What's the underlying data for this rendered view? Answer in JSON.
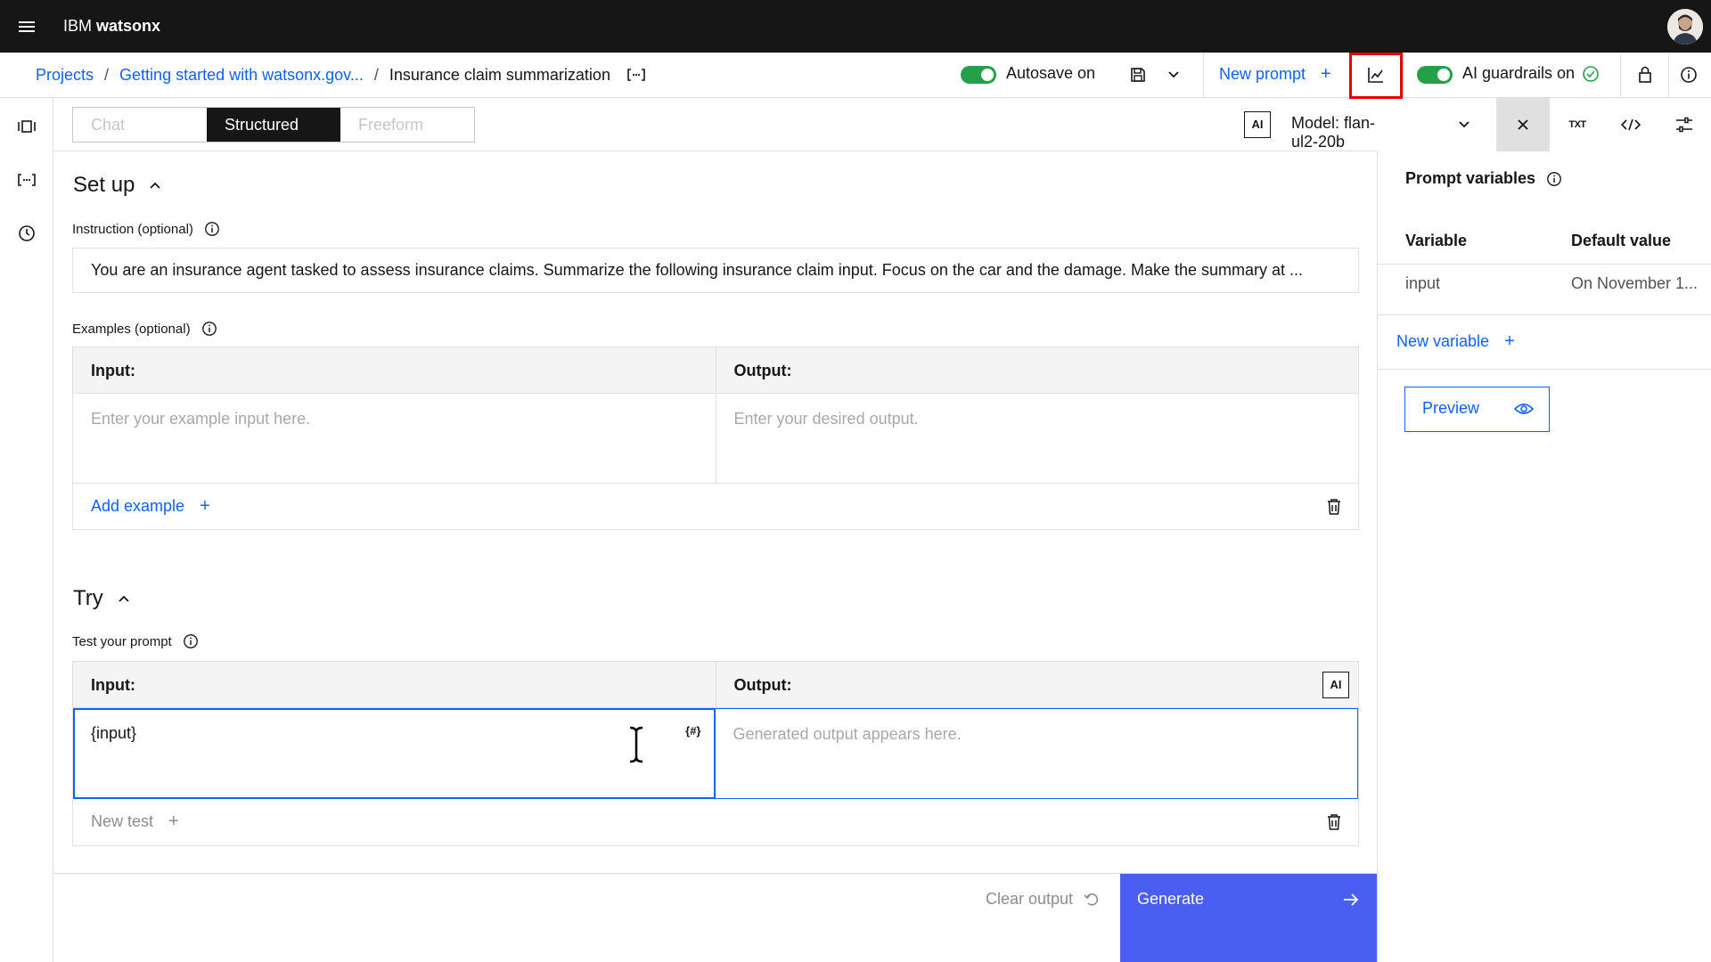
{
  "header": {
    "menu_icon": "hamburger-menu-icon",
    "brand_prefix": "IBM",
    "brand_name": "watsonx",
    "avatar_icon": "user-avatar"
  },
  "breadcrumb": {
    "items": [
      "Projects",
      "Getting started with watsonx.gov...",
      "Insurance claim summarization"
    ],
    "separator": "/",
    "variables_icon": "prompt-variables-icon"
  },
  "toolbar": {
    "autosave_label": "Autosave on",
    "save_icon": "save-icon",
    "dropdown_icon": "chevron-down-icon",
    "new_prompt_label": "New prompt",
    "new_prompt_icon": "plus-icon",
    "evaluate_icon": "chart-line-icon",
    "guardrails_label": "AI guardrails on",
    "guardrails_icon": "checkmark-outline-icon",
    "lock_icon": "lock-icon",
    "info_icon": "information-icon"
  },
  "left_nav": [
    "prompt-library-icon",
    "prompt-variables-icon",
    "history-icon"
  ],
  "mode_tabs": {
    "tabs": [
      "Chat",
      "Structured",
      "Freeform"
    ],
    "selected": "Structured"
  },
  "model": {
    "badge": "AI",
    "label": "Model: flan-ul2-20b",
    "close_icon": "close-icon",
    "txt_icon": "TXT",
    "code_icon": "code-icon",
    "settings_icon": "settings-adjust-icon"
  },
  "setup": {
    "title": "Set up",
    "instruction_label": "Instruction (optional)",
    "instruction_value": "You are an insurance agent tasked to assess insurance claims. Summarize the following insurance claim input. Focus on the car and the damage. Make the summary at ...",
    "examples_label": "Examples (optional)",
    "input_header": "Input:",
    "output_header": "Output:",
    "input_placeholder": "Enter your example input here.",
    "output_placeholder": "Enter your desired output.",
    "add_example_label": "Add example"
  },
  "try": {
    "title": "Try",
    "test_label": "Test your prompt",
    "input_header": "Input:",
    "output_header": "Output:",
    "ai_badge": "AI",
    "input_value": "{input}",
    "var_badge": "{#}",
    "output_placeholder": "Generated output appears here.",
    "new_test_label": "New test"
  },
  "footer": {
    "clear_output_label": "Clear output",
    "generate_label": "Generate"
  },
  "variables_panel": {
    "title": "Prompt variables",
    "col_variable": "Variable",
    "col_default": "Default value",
    "rows": [
      {
        "variable": "input",
        "default": "On November 1..."
      }
    ],
    "new_variable_label": "New variable",
    "preview_label": "Preview"
  },
  "colors": {
    "brand_blue": "#0f62fe",
    "generate_blue": "#4b5ef2",
    "toggle_green": "#24a148",
    "highlight_red": "#e50000",
    "topbar": "#161616"
  }
}
